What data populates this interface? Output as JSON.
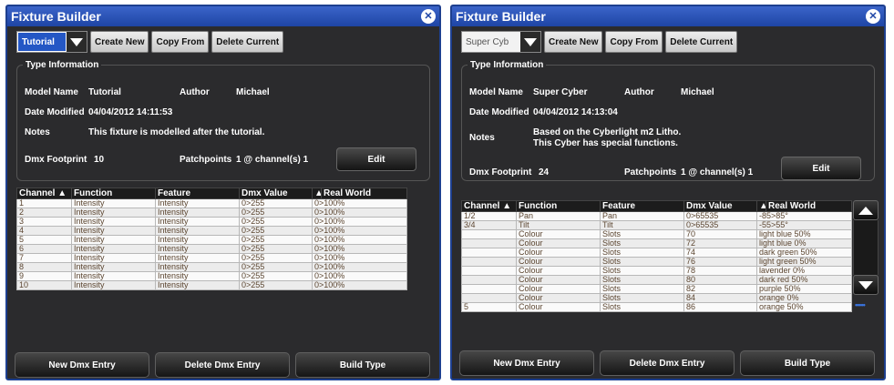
{
  "windows": [
    {
      "title": "Fixture Builder",
      "close_icon": "close-icon",
      "type_select": {
        "value": "Tutorial",
        "selected": true
      },
      "toolbar": {
        "create_new": "Create New",
        "copy_from": "Copy From",
        "delete_current": "Delete Current"
      },
      "type_info": {
        "legend": "Type Information",
        "model_name_label": "Model Name",
        "model_name": "Tutorial",
        "author_label": "Author",
        "author": "Michael",
        "date_label": "Date Modified",
        "date": "04/04/2012 14:11:53",
        "notes_label": "Notes",
        "notes": "This fixture is modelled after the tutorial.",
        "dmx_footprint_label": "Dmx Footprint",
        "dmx_footprint": "10",
        "patchpoints_label": "Patchpoints",
        "patchpoints": "1 @ channel(s)  1",
        "edit_label": "Edit"
      },
      "table": {
        "headers": [
          "Channel  ▲",
          "Function",
          "Feature",
          "Dmx Value",
          "▲",
          "Real World"
        ],
        "rows": [
          [
            "1",
            "Intensity",
            "Intensity",
            "0>255",
            "0>100%"
          ],
          [
            "2",
            "Intensity",
            "Intensity",
            "0>255",
            "0>100%"
          ],
          [
            "3",
            "Intensity",
            "Intensity",
            "0>255",
            "0>100%"
          ],
          [
            "4",
            "Intensity",
            "Intensity",
            "0>255",
            "0>100%"
          ],
          [
            "5",
            "Intensity",
            "Intensity",
            "0>255",
            "0>100%"
          ],
          [
            "6",
            "Intensity",
            "Intensity",
            "0>255",
            "0>100%"
          ],
          [
            "7",
            "Intensity",
            "Intensity",
            "0>255",
            "0>100%"
          ],
          [
            "8",
            "Intensity",
            "Intensity",
            "0>255",
            "0>100%"
          ],
          [
            "9",
            "Intensity",
            "Intensity",
            "0>255",
            "0>100%"
          ],
          [
            "10",
            "Intensity",
            "Intensity",
            "0>255",
            "0>100%"
          ]
        ]
      },
      "buttons": {
        "new_dmx": "New Dmx Entry",
        "delete_dmx": "Delete Dmx Entry",
        "build_type": "Build Type"
      }
    },
    {
      "title": "Fixture Builder",
      "close_icon": "close-icon",
      "type_select": {
        "value": "Super Cyb",
        "selected": false
      },
      "toolbar": {
        "create_new": "Create New",
        "copy_from": "Copy From",
        "delete_current": "Delete Current"
      },
      "type_info": {
        "legend": "Type Information",
        "model_name_label": "Model Name",
        "model_name": "Super Cyber",
        "author_label": "Author",
        "author": "Michael",
        "date_label": "Date Modified",
        "date": "04/04/2012 14:13:04",
        "notes_label": "Notes",
        "notes": "Based on the Cyberlight m2 Litho. This Cyber has special functions.",
        "dmx_footprint_label": "Dmx Footprint",
        "dmx_footprint": "24",
        "patchpoints_label": "Patchpoints",
        "patchpoints": "1 @ channel(s)  1",
        "edit_label": "Edit"
      },
      "table": {
        "headers": [
          "Channel  ▲",
          "Function",
          "Feature",
          "Dmx Value",
          "▲",
          "Real World"
        ],
        "rows": [
          [
            "1/2",
            "Pan",
            "Pan",
            "0>65535",
            "-85>85°"
          ],
          [
            "3/4",
            "Tilt",
            "Tilt",
            "0>65535",
            "-55>55°"
          ],
          [
            "",
            "Colour",
            "Slots",
            "70",
            "light blue 50%"
          ],
          [
            "",
            "Colour",
            "Slots",
            "72",
            "light blue 0%"
          ],
          [
            "",
            "Colour",
            "Slots",
            "74",
            "dark green 50%"
          ],
          [
            "",
            "Colour",
            "Slots",
            "76",
            "light green 50%"
          ],
          [
            "",
            "Colour",
            "Slots",
            "78",
            "lavender 0%"
          ],
          [
            "",
            "Colour",
            "Slots",
            "80",
            "dark red 50%"
          ],
          [
            "",
            "Colour",
            "Slots",
            "82",
            "purple 50%"
          ],
          [
            "",
            "Colour",
            "Slots",
            "84",
            "orange 0%"
          ],
          [
            "5",
            "Colour",
            "Slots",
            "86",
            "orange 50%"
          ]
        ]
      },
      "scroll_dots": "•••••",
      "buttons": {
        "new_dmx": "New Dmx Entry",
        "delete_dmx": "Delete Dmx Entry",
        "build_type": "Build Type"
      }
    }
  ]
}
